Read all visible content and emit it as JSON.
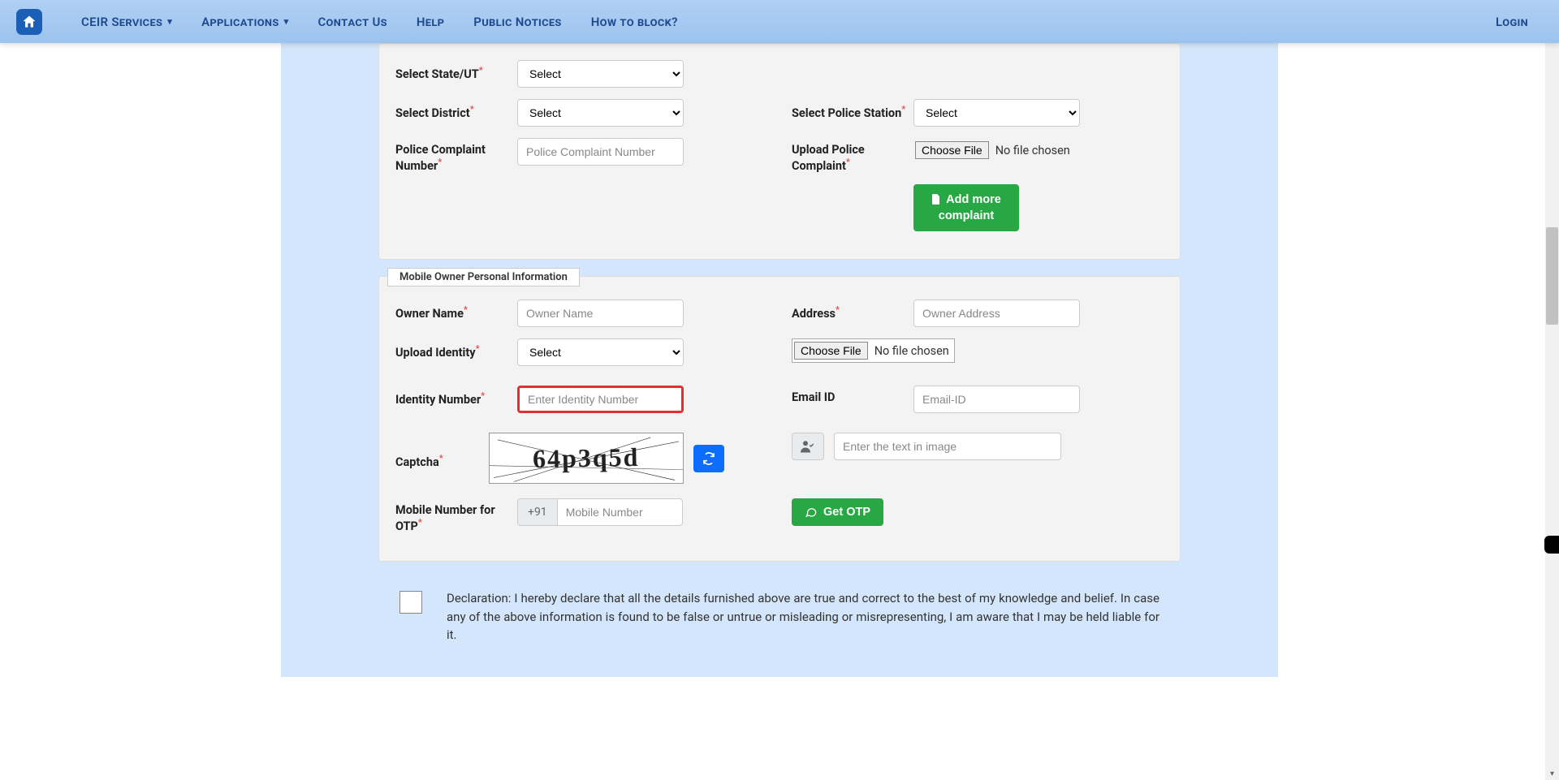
{
  "nav": {
    "items": [
      "CEIR Services",
      "Applications",
      "Contact Us",
      "Help",
      "Public Notices",
      "How to block?"
    ],
    "login": "Login"
  },
  "section1": {
    "state_label": "Select State/UT",
    "district_label": "Select District",
    "police_station_label": "Select Police Station",
    "complaint_num_label": "Police Complaint Number",
    "complaint_placeholder": "Police Complaint Number",
    "upload_label": "Upload Police Complaint",
    "select_default": "Select",
    "choose_file": "Choose File",
    "no_file": "No file chosen",
    "add_more": "Add more complaint"
  },
  "section2": {
    "title": "Mobile Owner Personal Information",
    "owner_label": "Owner Name",
    "owner_placeholder": "Owner Name",
    "address_label": "Address",
    "address_placeholder": "Owner Address",
    "identity_label": "Upload Identity",
    "idnum_label": "Identity Number",
    "idnum_placeholder": "Enter Identity Number",
    "email_label": "Email ID",
    "email_placeholder": "Email-ID",
    "captcha_label": "Captcha",
    "captcha_value": "64p3q5d",
    "captcha_placeholder": "Enter the text in image",
    "mobile_label": "Mobile Number for OTP",
    "prefix": "+91",
    "mobile_placeholder": "Mobile Number",
    "get_otp": "Get OTP"
  },
  "declaration": "Declaration: I hereby declare that all the details furnished above are true and correct to the best of my knowledge and belief. In case any of the above information is found to be false or untrue or misleading or misrepresenting, I am aware that I may be held liable for it."
}
